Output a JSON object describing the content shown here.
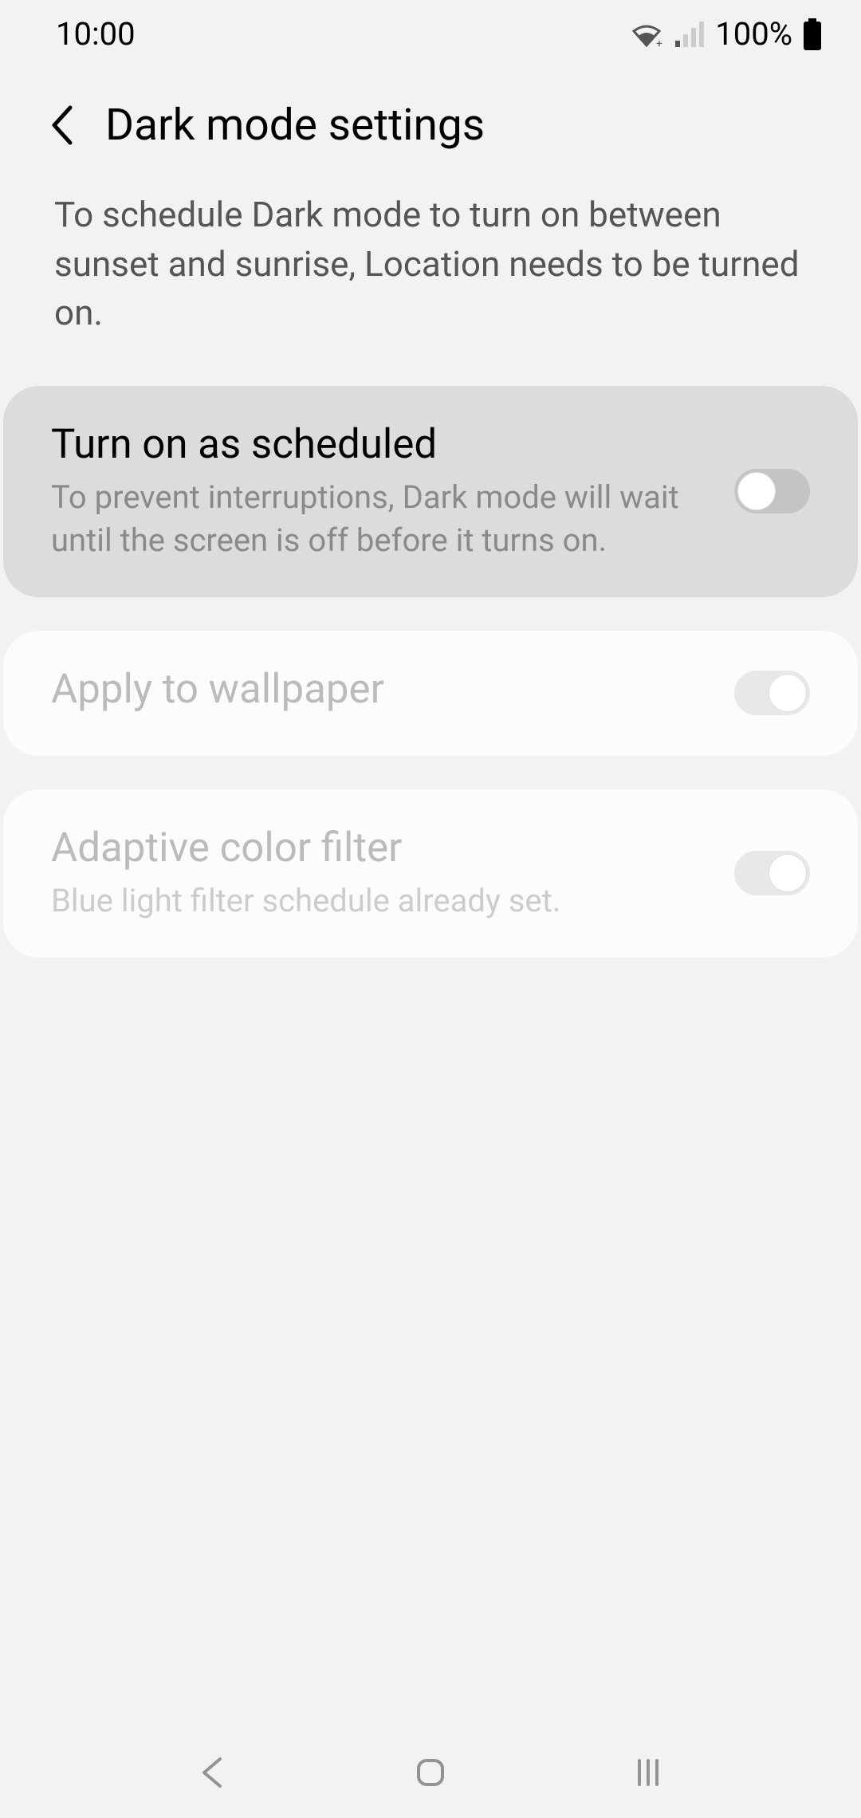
{
  "statusBar": {
    "time": "10:00",
    "battery": "100%"
  },
  "header": {
    "title": "Dark mode settings"
  },
  "infoText": "To schedule Dark mode to turn on between sunset and sunrise, Location needs to be turned on.",
  "settings": [
    {
      "title": "Turn on as scheduled",
      "subtitle": "To prevent interruptions, Dark mode will wait until the screen is off before it turns on.",
      "toggleState": "off",
      "highlighted": true,
      "disabled": false
    },
    {
      "title": "Apply to wallpaper",
      "subtitle": "",
      "toggleState": "on",
      "highlighted": false,
      "disabled": true
    },
    {
      "title": "Adaptive color filter",
      "subtitle": "Blue light filter schedule already set.",
      "toggleState": "on",
      "highlighted": false,
      "disabled": true
    }
  ]
}
